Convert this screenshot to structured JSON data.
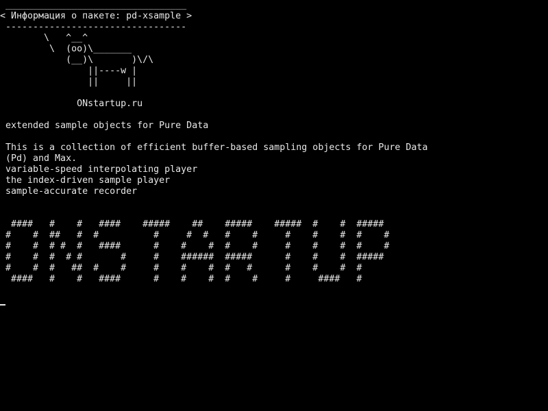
{
  "cowsay": {
    "border_top": " _________________________________ ",
    "message": "< Информация о пакете: pd-xsample >",
    "border_bottom": " --------------------------------- ",
    "cow_line_1": "        \\   ^__^",
    "cow_line_2": "         \\  (oo)\\_______",
    "cow_line_3": "            (__)\\       )\\/\\",
    "cow_line_4": "                ||----w |",
    "cow_line_5": "                ||     ||",
    "site": "              ONstartup.ru"
  },
  "package": {
    "summary": " extended sample objects for Pure Data",
    "description_line_1": " This is a collection of efficient buffer-based sampling objects for Pure Data",
    "description_line_2": " (Pd) and Max.",
    "feature_1": " variable-speed interpolating player",
    "feature_2": " the index-driven sample player",
    "feature_3": " sample-accurate recorder"
  },
  "banner": {
    "row_1": "  ####   #    #   ####    #####    ##    #####    #####  #    #  #####",
    "row_2": " #    #  ##   #  #          #     #  #   #    #     #    #    #  #    #",
    "row_3": " #    #  # #  #   ####      #    #    #  #    #     #    #    #  #    #",
    "row_4": " #    #  #  # #       #     #    ######  #####      #    #    #  #####",
    "row_5": " #    #  #   ##  #    #     #    #    #  #   #      #    #    #  #",
    "row_6": "  ####   #    #   ####      #    #    #  #    #     #     ####   #"
  }
}
